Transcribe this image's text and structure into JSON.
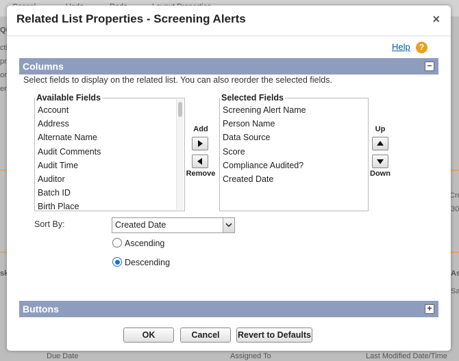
{
  "background": {
    "top_tabs": [
      "Cancel",
      "Undo",
      "Redo",
      "Layout Properties"
    ],
    "left_fragments": [
      "Qu",
      "ctiv",
      "pro",
      "omp",
      "ente"
    ],
    "right_fragments": [
      "Crea",
      "30",
      "As",
      "Sa"
    ],
    "bottom_fragments": [
      "Due Date",
      "Assigned To",
      "Last Modified Date/Time"
    ],
    "left_mid_fragments": [
      "sk"
    ]
  },
  "dialog": {
    "title": "Related List Properties - Screening Alerts",
    "close_glyph": "×",
    "help_label": "Help",
    "help_icon_glyph": "?"
  },
  "columns_section": {
    "title": "Columns",
    "toggle_glyph": "−",
    "instructions": "Select fields to display on the related list. You can also reorder the selected fields.",
    "available_title": "Available Fields",
    "available_fields": [
      "Account",
      "Address",
      "Alternate Name",
      "Audit Comments",
      "Audit Time",
      "Auditor",
      "Batch ID",
      "Birth Place"
    ],
    "add_label": "Add",
    "remove_label": "Remove",
    "selected_title": "Selected Fields",
    "selected_fields": [
      "Screening Alert Name",
      "Person Name",
      "Data Source",
      "Score",
      "Compliance Audited?",
      "Created Date"
    ],
    "up_label": "Up",
    "down_label": "Down"
  },
  "sort": {
    "label": "Sort By:",
    "value": "Created Date",
    "ascending_label": "Ascending",
    "descending_label": "Descending",
    "selected": "descending"
  },
  "buttons_section": {
    "title": "Buttons",
    "toggle_glyph": "+"
  },
  "footer": {
    "ok_label": "OK",
    "cancel_label": "Cancel",
    "revert_label": "Revert to Defaults"
  },
  "colors": {
    "section_bar": "#8e9dbe",
    "help_icon": "#e8a022",
    "link": "#015ba7",
    "radio_selected": "#1c6fd6"
  }
}
